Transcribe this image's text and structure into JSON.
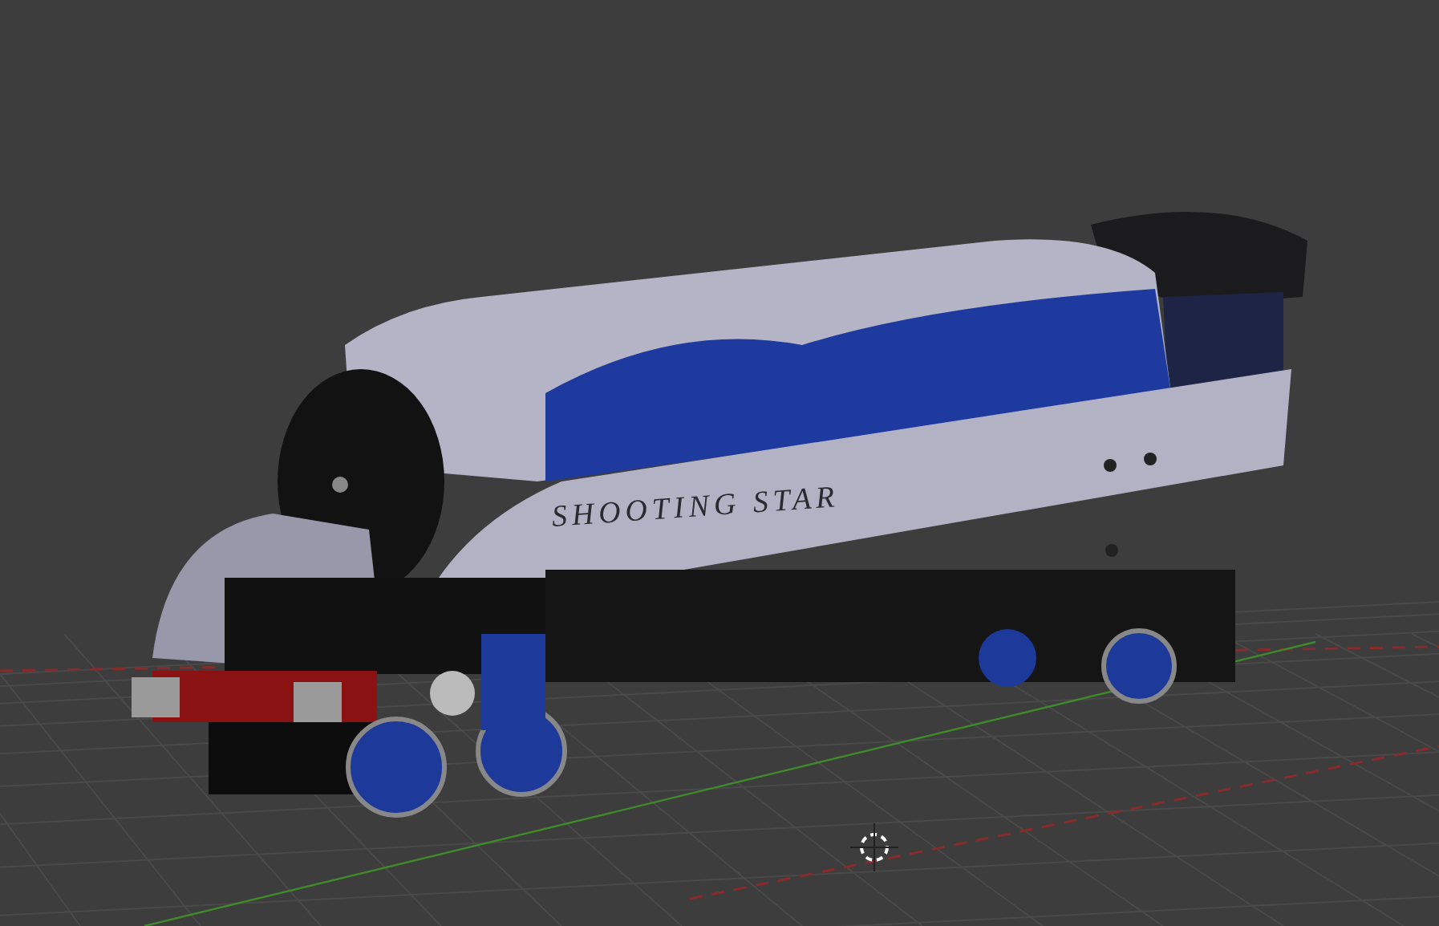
{
  "viewport": {
    "model_lettering": "SHOOTING STAR"
  }
}
